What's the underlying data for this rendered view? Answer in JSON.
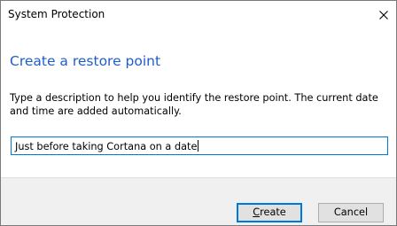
{
  "window": {
    "title": "System Protection"
  },
  "dialog": {
    "heading": "Create a restore point",
    "description": "Type a description to help you identify the restore point. The current date and time are added automatically.",
    "description_input_value": "Just before taking Cortana on a date"
  },
  "buttons": {
    "create_mnemonic": "C",
    "create_rest": "reate",
    "cancel_label": "Cancel"
  },
  "icons": {
    "close": "close-icon"
  },
  "colors": {
    "heading": "#1e5ec9",
    "focus_border": "#0078d7",
    "footer_bg": "#f0f0f0"
  }
}
